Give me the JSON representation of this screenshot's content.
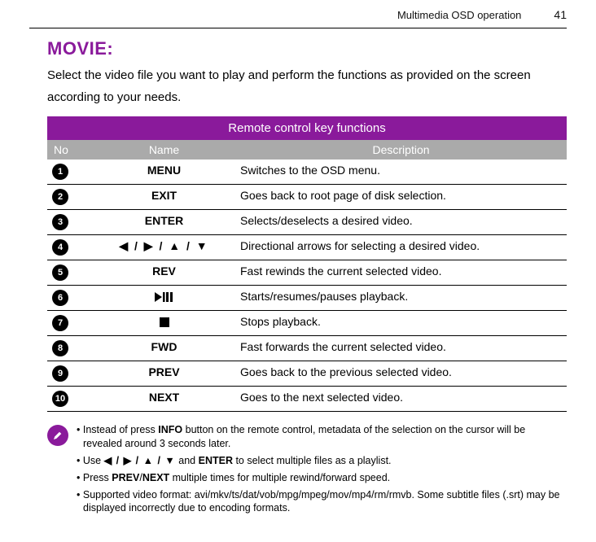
{
  "header": {
    "section": "Multimedia OSD operation",
    "page": "41"
  },
  "title": "MOVIE:",
  "intro": "Select the video file you want to play and perform the functions as provided on the screen according to your needs.",
  "table": {
    "caption": "Remote control key functions",
    "columns": {
      "no": "No",
      "name": "Name",
      "desc": "Description"
    },
    "rows": [
      {
        "no": "1",
        "name": "MENU",
        "desc": "Switches to the OSD menu."
      },
      {
        "no": "2",
        "name": "EXIT",
        "desc": "Goes back to root page of disk selection."
      },
      {
        "no": "3",
        "name": "ENTER",
        "desc": "Selects/deselects a desired video."
      },
      {
        "no": "4",
        "name_icon": "arrows",
        "desc": "Directional arrows for selecting a desired video."
      },
      {
        "no": "5",
        "name": "REV",
        "desc": "Fast rewinds the current selected video."
      },
      {
        "no": "6",
        "name_icon": "playpause",
        "desc": "Starts/resumes/pauses playback."
      },
      {
        "no": "7",
        "name_icon": "stop",
        "desc": "Stops playback."
      },
      {
        "no": "8",
        "name": "FWD",
        "desc": "Fast forwards the current selected video."
      },
      {
        "no": "9",
        "name": "PREV",
        "desc": "Goes back to the previous selected video."
      },
      {
        "no": "10",
        "name": "NEXT",
        "desc": "Goes to the next selected video."
      }
    ]
  },
  "arrows_text": "◀ / ▶ / ▲ / ▼",
  "notes": {
    "items": {
      "n1a": "Instead of press ",
      "n1b": "INFO",
      "n1c": " button on the remote control, metadata of the selection on the cursor will be revealed around 3 seconds later.",
      "n2a": "Use ",
      "n2b": "◀ / ▶ / ▲ / ▼",
      "n2c": " and ",
      "n2d": "ENTER",
      "n2e": " to select multiple files as a playlist.",
      "n3a": "Press ",
      "n3b": "PREV",
      "n3c": "/",
      "n3d": "NEXT",
      "n3e": " multiple times for multiple rewind/forward speed.",
      "n4": "Supported video format: avi/mkv/ts/dat/vob/mpg/mpeg/mov/mp4/rm/rmvb. Some subtitle files (.srt) may be displayed incorrectly due to encoding formats."
    }
  }
}
